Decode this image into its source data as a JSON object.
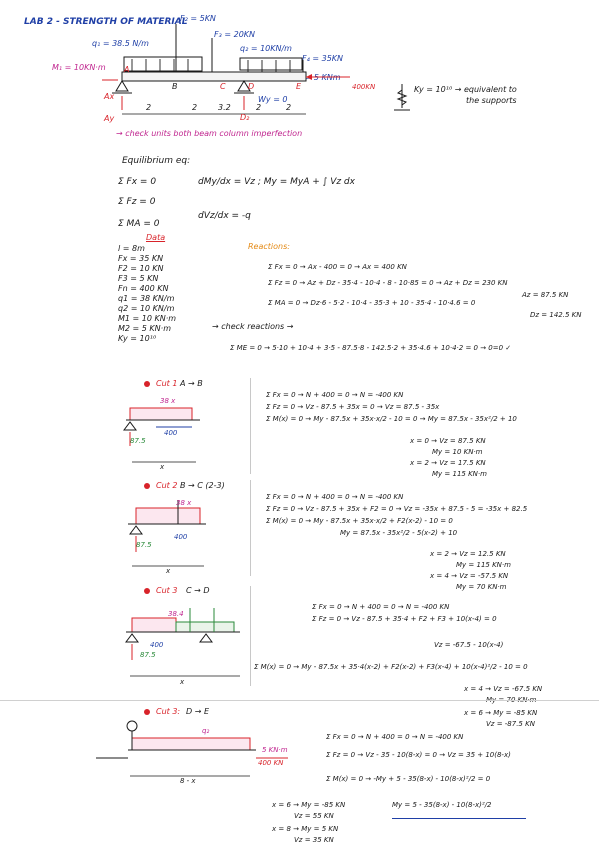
{
  "header": {
    "title": "LAB 2 - STRENGTH OF MATERIAL"
  },
  "beam": {
    "f2": "F₂ = 5KN",
    "f3": "F₃ = 20KN",
    "q1": "q₁ = 38.5 N/m",
    "q2": "q₂ = 10KN/m",
    "f4": "F₄ = 35KN",
    "m1": "M₁ = 10KN·m",
    "m2": "M₂ = 5 KNm",
    "ra_ext": "400KN",
    "ky_label": "Ky = 10¹⁰ → equivalent to",
    "ky_label2": "the supports",
    "spans": [
      "2",
      "2",
      "3.2",
      "2",
      "2"
    ],
    "points": [
      "A",
      "B",
      "C",
      "D",
      "E"
    ],
    "ax": "Ax",
    "ay": "Ay",
    "d2": "D₂",
    "wy": "Wy = 0",
    "check_note": "→ check units both beam column imperfection"
  },
  "equilibrium": {
    "heading": "Equilibrium eq:",
    "eq1": "Σ Fx = 0",
    "eq2": "Σ Fz = 0",
    "eq3": "Σ MA = 0",
    "diff1": "dMy/dx = Vz ; My = MyA + ∫ Vz dx",
    "diff2": "dVz/dx = -q"
  },
  "data": {
    "title": "Data",
    "items": [
      "l = 8m",
      "Fx = 35 KN",
      "F2 = 10 KN",
      "F3 = 5 KN",
      "Fn = 400 KN",
      "q1 = 38 KN/m",
      "q2 = 10 KN/m",
      "M1 = 10 KN·m",
      "M2 = 5 KN·m",
      "Ky = 10¹⁰"
    ]
  },
  "reactions": {
    "title": "Reactions:",
    "r1": "Σ Fx = 0 → Ax - 400 = 0 → Ax = 400 KN",
    "r2": "Σ Fz = 0 → Az + Dz - 35·4 - 10·4 - 8 - 10·85 = 0 → Az + Dz = 230 KN",
    "r2b": "Az = 87.5 KN",
    "r3": "Σ MA = 0 → Dz·6 - 5·2 - 10·4 - 35·3 + 10 - 35·4 - 10·4.6 = 0",
    "r3b": "Dz = 142.5 KN",
    "check_label": "→ check reactions →",
    "check": "Σ ME = 0 → 5·10 + 10·4 + 3·5 - 87.5·8 - 142.5·2 + 35·4.6 + 10·4·2 = 0 → 0=0 ✓"
  },
  "cuts": [
    {
      "label": "Cut 1",
      "range": "A → B",
      "diag_load": "38 x",
      "diag_ax": "400",
      "diag_az": "87.5",
      "diag_x": "x",
      "eqs": [
        "Σ Fx = 0 → N + 400 = 0 → N = -400 KN",
        "Σ Fz = 0 → Vz - 87.5 + 35x = 0 → Vz = 87.5 - 35x",
        "Σ M(x) = 0 → My - 87.5x + 35x·x/2 - 10 = 0 → My = 87.5x - 35x²/2 + 10"
      ],
      "vals": [
        "x = 0 → Vz = 87.5 KN",
        "My = 10 KN·m",
        "x = 2 → Vz = 17.5 KN",
        "My = 115 KN·m"
      ]
    },
    {
      "label": "Cut 2",
      "range": "B → C (2-3)",
      "diag_load": "38 x",
      "diag_ax": "400",
      "diag_az": "87.5",
      "diag_x": "x",
      "eqs": [
        "Σ Fx = 0 → N + 400 = 0 → N = -400 KN",
        "Σ Fz = 0 → Vz - 87.5 + 35x + F2 = 0 → Vz = -35x + 87.5 - 5 = -35x + 82.5",
        "Σ M(x) = 0 → My - 87.5x + 35x·x/2 + F2(x-2) - 10 = 0",
        "My = 87.5x - 35x²/2 - 5(x-2) + 10"
      ],
      "vals": [
        "x = 2 → Vz = 12.5 KN",
        "My = 115 KN·m",
        "x = 4 → Vz = -57.5 KN",
        "My = 70 KN·m"
      ]
    },
    {
      "label": "Cut 3",
      "range": "C → D",
      "diag_load": "38.4",
      "diag_ax": "400",
      "diag_az": "87.5",
      "diag_x": "x",
      "eqs": [
        "Σ Fx = 0 → N + 400 = 0 → N = -400 KN",
        "Σ Fz = 0 → Vz - 87.5 + 35·4 + F2 + F3 + 10(x-4) = 0",
        "Vz = -67.5 - 10(x-4)",
        "Σ M(x) = 0 → My - 87.5x + 35·4(x-2) + F2(x-2) + F3(x-4) + 10(x-4)²/2 - 10 = 0"
      ],
      "vals": [
        "x = 4 → Vz = -67.5 KN",
        "My = 70 KN·m",
        "x = 6 → My = -85 KN",
        "Vz = -87.5 KN"
      ]
    },
    {
      "label": "Cut 3:",
      "range": "D → E",
      "diag_load": "q₂",
      "diag_ax": "400 KN",
      "diag_az": "5 KN·m",
      "diag_x": "8 - x",
      "eqs": [
        "Σ Fx = 0 → N + 400 = 0 → N = -400 KN",
        "Σ Fz = 0 → Vz - 35 - 10(8-x) = 0 → Vz = 35 + 10(8-x)",
        "Σ M(x) = 0 → -My + 5 - 35(8-x) - 10(8-x)²/2 = 0",
        "My = 5 - 35(8-x) - 10(8-x)²/2"
      ],
      "vals": [
        "x = 6 → My = -85 KN",
        "Vz = 55 KN",
        "x = 8 → My = 5 KN",
        "Vz = 35 KN"
      ]
    }
  ],
  "colors": {
    "ink": "#1a1a1a",
    "blue": "#1f3fa6",
    "red": "#d8232a",
    "magenta": "#c0268f",
    "purple": "#7b3fc7",
    "green": "#2a8a3a",
    "orange": "#e48a16"
  }
}
